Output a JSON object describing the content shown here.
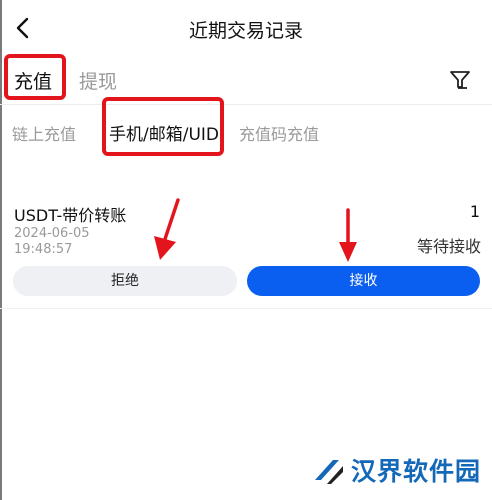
{
  "header": {
    "title": "近期交易记录",
    "back_icon": "chevron-left-icon"
  },
  "tabs": [
    {
      "label": "充值",
      "active": true
    },
    {
      "label": "提现",
      "active": false
    }
  ],
  "filter_icon": "filter-icon",
  "subtabs": [
    {
      "label": "链上充值",
      "active": false
    },
    {
      "label": "手机/邮箱/UID",
      "active": true
    },
    {
      "label": "充值码充值",
      "active": false
    }
  ],
  "record": {
    "title": "USDT-带价转账",
    "count": "1",
    "date": "2024-06-05",
    "time": "19:48:57",
    "status": "等待接收",
    "reject_label": "拒绝",
    "accept_label": "接收"
  },
  "colors": {
    "accent": "#0a5ff0",
    "highlight": "#e4141d",
    "muted": "#9a9a9a"
  },
  "watermark": {
    "text": "汉界软件园"
  }
}
